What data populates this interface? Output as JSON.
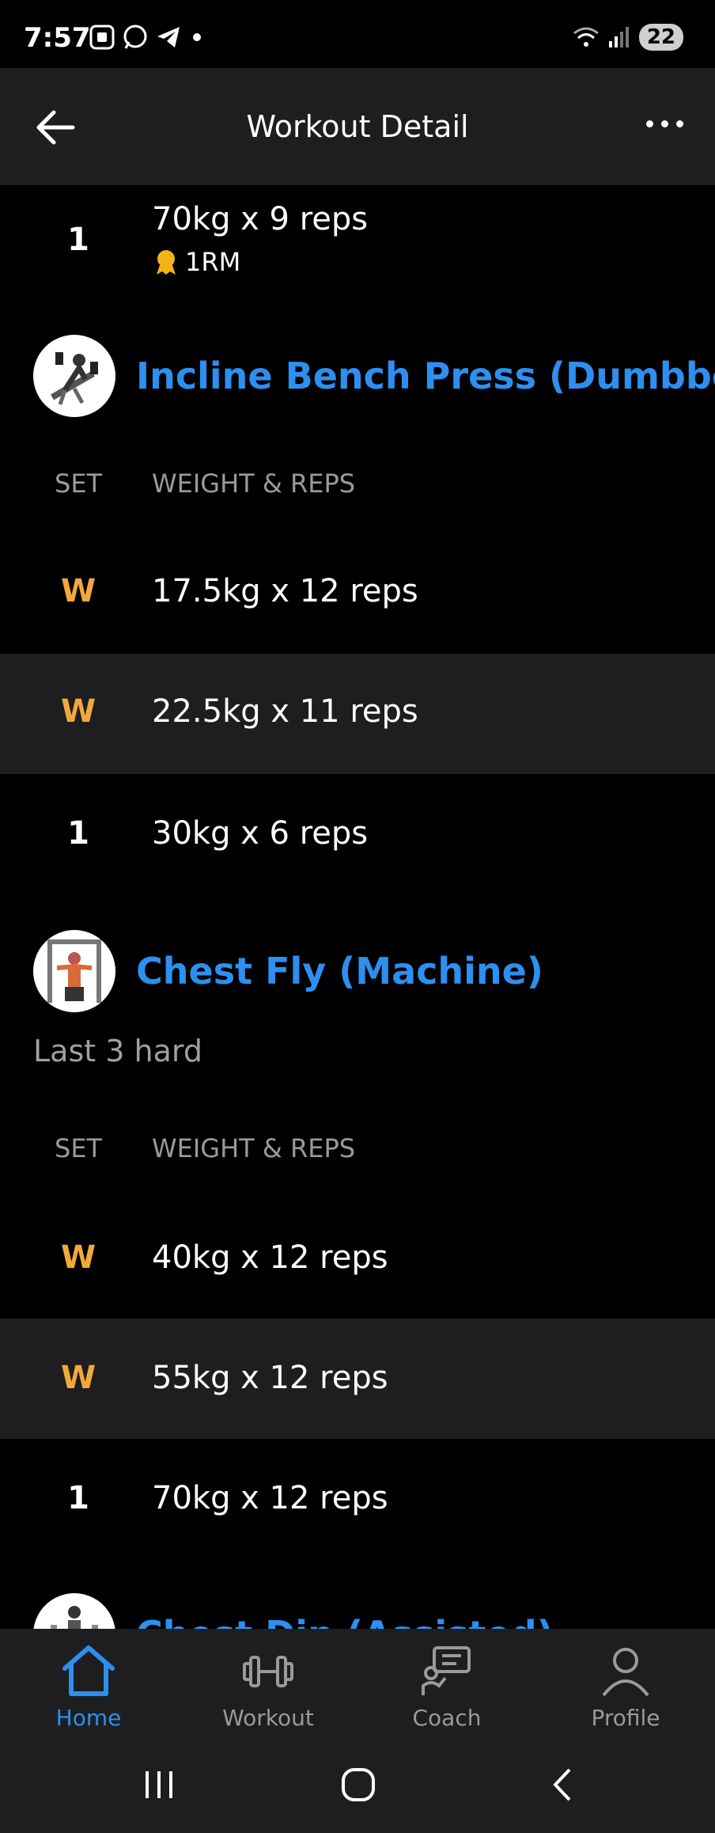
{
  "status_bar": {
    "time": "7:57",
    "battery": "22"
  },
  "header": {
    "title": "Workout Detail"
  },
  "previous_set": {
    "set": "1",
    "weight_reps": "70kg x 9 reps",
    "badge": "1RM"
  },
  "exercises": [
    {
      "name": "Incline Bench Press (Dumbbell)",
      "col_set": "SET",
      "col_weight": "WEIGHT & REPS",
      "sets": [
        {
          "set": "W",
          "weight_reps": "17.5kg x 12 reps"
        },
        {
          "set": "W",
          "weight_reps": "22.5kg x 11 reps"
        },
        {
          "set": "1",
          "weight_reps": "30kg x 6 reps"
        }
      ]
    },
    {
      "name": "Chest Fly (Machine)",
      "note": "Last 3 hard",
      "col_set": "SET",
      "col_weight": "WEIGHT & REPS",
      "sets": [
        {
          "set": "W",
          "weight_reps": "40kg x 12 reps"
        },
        {
          "set": "W",
          "weight_reps": "55kg x 12 reps"
        },
        {
          "set": "1",
          "weight_reps": "70kg x 12 reps"
        }
      ]
    },
    {
      "name": "Chest Dip (Assisted)"
    }
  ],
  "nav": {
    "home": "Home",
    "workout": "Workout",
    "coach": "Coach",
    "profile": "Profile"
  },
  "colors": {
    "accent": "#2d8ff0",
    "warmup": "#f2a93b",
    "panel": "#1e1e20"
  }
}
